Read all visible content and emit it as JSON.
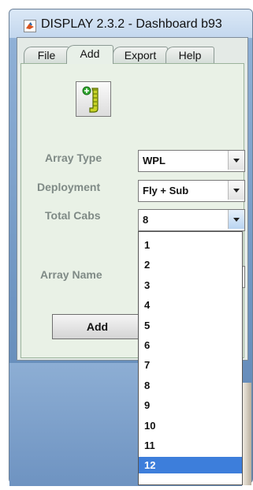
{
  "window": {
    "title": "DISPLAY 2.3.2 - Dashboard  b93"
  },
  "menu_tabs": [
    {
      "label": "File"
    },
    {
      "label": "Add"
    },
    {
      "label": "Export"
    },
    {
      "label": "Help"
    }
  ],
  "form": {
    "array_type": {
      "label": "Array Type",
      "value": "WPL"
    },
    "deployment": {
      "label": "Deployment",
      "value": "Fly + Sub"
    },
    "total_cabs": {
      "label": "Total Cabs",
      "value": "8"
    },
    "array_name": {
      "label": "Array Name",
      "value": ""
    },
    "add_button": "Add"
  },
  "dropdown": {
    "options": [
      "1",
      "2",
      "3",
      "4",
      "5",
      "6",
      "7",
      "8",
      "9",
      "10",
      "11",
      "12"
    ],
    "highlighted": "12"
  },
  "colors": {
    "selection": "#3d7edb",
    "panel": "#e9f1e6"
  },
  "icons": [
    "matlab-logo-icon",
    "add-array-icon",
    "chevron-down-icon"
  ]
}
